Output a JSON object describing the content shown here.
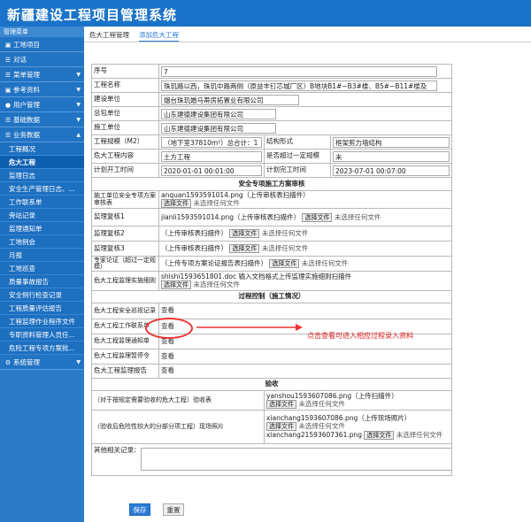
{
  "app": {
    "title": "新疆建设工程项目管理系统"
  },
  "sidebar": {
    "heading": "管理菜单",
    "items": [
      {
        "label": "工地项目",
        "icon": "book-icon"
      },
      {
        "label": "对话",
        "icon": "list-icon"
      },
      {
        "label": "菜单管理",
        "icon": "list-icon"
      },
      {
        "label": "参考资料",
        "icon": "book-icon"
      },
      {
        "label": "用户管理",
        "icon": "user-icon"
      },
      {
        "label": "基础数据",
        "icon": "list-icon"
      },
      {
        "label": "业务数据",
        "icon": "list-icon"
      }
    ],
    "subitems": [
      "工程概况",
      "危大工程",
      "监理日志",
      "安全生产管理日志、...",
      "工作联系单",
      "旁站记录",
      "监理通知单",
      "工地例会",
      "月报",
      "工地巡查",
      "质量事故报告",
      "安全例行检查记录",
      "工程质量评估报告",
      "工程监理作业程序文件",
      "专职资料管理人员任...",
      "危险工程专项方案批..."
    ],
    "footer": {
      "label": "系统管理",
      "icon": "gear-icon"
    }
  },
  "tabs": [
    "危大工程管理",
    "添加危大工程"
  ],
  "form": {
    "seq_label": "序号",
    "seq": "7",
    "name_label": "工程名称",
    "name": "珠玑路以西，珠玑中路两侧（原益丰钉芯城厂区）B地块B1#~B3#楼、B5#~B11#楼及",
    "builder_label": "建设单位",
    "builder": "烟台珠玑婚马蒂房拓置业有限公司",
    "general_label": "总包单位",
    "general": "山东建德建设集团有限公司",
    "construct_label": "施工单位",
    "construct": "山东建德建设集团有限公司",
    "scale_label": "工程规模（M2）",
    "scale": "（地下室37810m²）总合计：1",
    "struct_label": "结构形式",
    "struct": "框架剪力墙结构",
    "content_label": "危大工程内容",
    "content": "土方工程",
    "exceed_label": "是否超过一定规模",
    "exceed": "未",
    "start_label": "计划开工时间",
    "start": "2020-01-01 00:01:00",
    "end_label": "计划完工时间",
    "end": "2023-07-01 00:07:00"
  },
  "audit": {
    "title": "安全专项施工方案审核",
    "rows": [
      {
        "label": "施工单位安全专项方案审核表",
        "file": "anquan1593591014.png（上传审核表扫描件）",
        "btn": "选择文件",
        "status": "未选择任何文件"
      },
      {
        "label": "监理复核1",
        "file": "jianli1593591014.png（上传审核表扫描件）",
        "btn": "选择文件",
        "status": "未选择任何文件"
      },
      {
        "label": "监理复核2",
        "file": "（上传审核表扫描件）",
        "btn": "选择文件",
        "status": "未选择任何文件"
      },
      {
        "label": "监理复核3",
        "file": "（上传审核表扫描件）",
        "btn": "选择文件",
        "status": "未选择任何文件"
      },
      {
        "label": "专家论证（超过一定规模）",
        "file": "（上传专项方案论证报告表扫描件）",
        "btn": "选择文件",
        "status": "未选择任何文件"
      },
      {
        "label": "危大工程监理实施细则",
        "file": "shishi1593651801.doc 输入文档格式上传监理实施细则扫描件",
        "btn": "选择文件",
        "status": "未选择任何文件"
      }
    ]
  },
  "process": {
    "title": "过程控制（施工情况）",
    "rows": [
      {
        "label": "危大工程安全巡视记录",
        "link": "查看"
      },
      {
        "label": "危大工程工作联系单",
        "link": "查看"
      },
      {
        "label": "危大工程监理通知单",
        "link": "查看"
      },
      {
        "label": "危大工程监理暂停令",
        "link": "查看"
      },
      {
        "label": "危大工程监理报告",
        "link": "查看"
      }
    ],
    "note": "点击查看可进入相应过程录入资料"
  },
  "acceptance": {
    "title": "验收",
    "row1": {
      "label": "（对于按规定需要验收的危大工程）验收表",
      "file": "yanshou1593607086.png（上传扫描件）",
      "btn": "选择文件",
      "status": "未选择任何文件"
    },
    "row2": {
      "label": "（验收后危险性较大的分部分项工程）现场照片",
      "file1": "xianchang1593607086.png（上传现场照片）",
      "btn1": "选择文件",
      "status1": "未选择任何文件",
      "file2": "xianchang21593607361.png",
      "btn2": "选择文件",
      "status2": "未选择任何文件"
    },
    "other_label": "其他相关记录："
  },
  "buttons": {
    "save": "保存",
    "reset": "重置"
  }
}
